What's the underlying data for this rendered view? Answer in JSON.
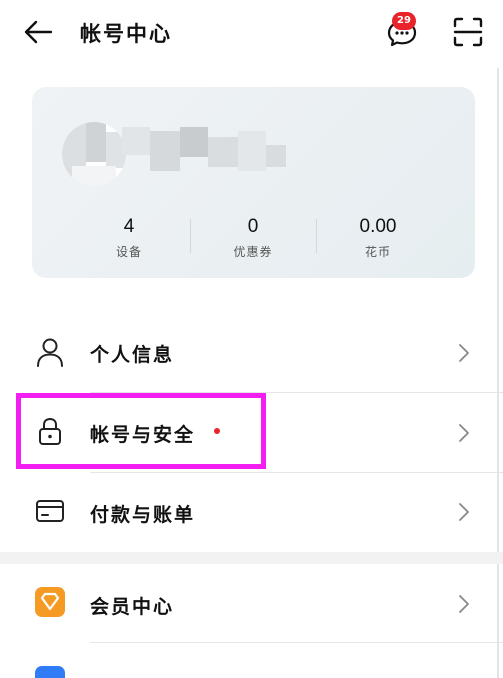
{
  "header": {
    "title": "帐号中心",
    "message_count": "29"
  },
  "profile": {
    "stats": [
      {
        "value": "4",
        "label": "设备"
      },
      {
        "value": "0",
        "label": "优惠券"
      },
      {
        "value": "0.00",
        "label": "花币"
      }
    ]
  },
  "menu": {
    "items": [
      {
        "label": "个人信息",
        "icon": "person-icon"
      },
      {
        "label": "帐号与安全",
        "icon": "lock-icon"
      },
      {
        "label": "付款与账单",
        "icon": "card-icon"
      },
      {
        "label": "会员中心",
        "icon": "vip-diamond-icon"
      }
    ]
  },
  "colors": {
    "highlight": "#f21ef2",
    "badge": "#e8232a",
    "vip_orange": "#f59a23"
  }
}
